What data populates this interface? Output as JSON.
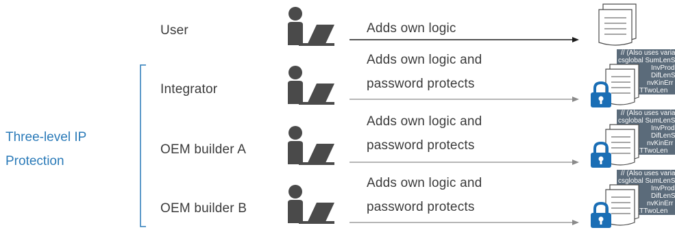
{
  "colors": {
    "accent": "#2a7ab8",
    "person": "#4a4a4a",
    "text": "#3a3a3a",
    "lock": "#1a6eb5",
    "code_bg": "#5b6b7a"
  },
  "group": {
    "label_line1": "Three-level IP",
    "label_line2": "Protection"
  },
  "rows": [
    {
      "role": "User",
      "action_line1": "Adds own logic",
      "action_line2": "",
      "protected": false
    },
    {
      "role": "Integrator",
      "action_line1": "Adds own logic and",
      "action_line2": "password protects",
      "protected": true
    },
    {
      "role": "OEM builder A",
      "action_line1": "Adds own logic and",
      "action_line2": "password protects",
      "protected": true
    },
    {
      "role": "OEM builder B",
      "action_line1": "Adds own logic and",
      "action_line2": "password protects",
      "protected": true
    }
  ],
  "code_snippet": [
    "// (Also uses varia",
    "csglobal SumLenS",
    "InvProdC",
    "DifLenSc",
    "nvKinErr",
    "paTTwoLen"
  ]
}
